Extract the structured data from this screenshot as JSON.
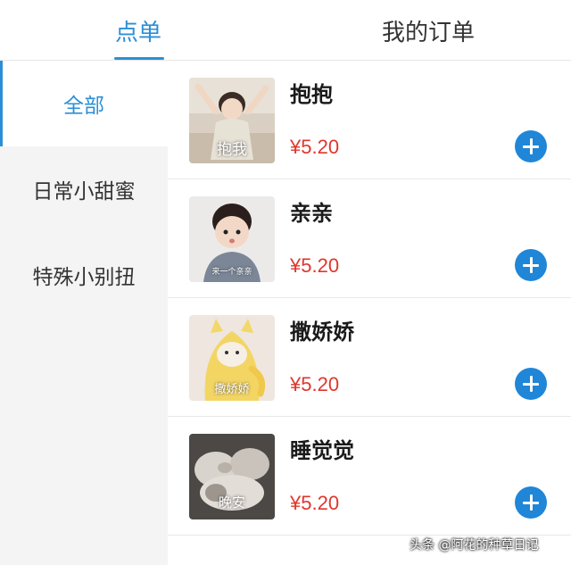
{
  "tabs": {
    "order": "点单",
    "my_orders": "我的订单"
  },
  "sidebar": {
    "items": [
      {
        "label": "全部"
      },
      {
        "label": "日常小甜蜜"
      },
      {
        "label": "特殊小别扭"
      }
    ]
  },
  "products": [
    {
      "name": "抱抱",
      "price": "¥5.20",
      "image_caption": "抱我"
    },
    {
      "name": "亲亲",
      "price": "¥5.20",
      "image_caption": "来一个亲亲"
    },
    {
      "name": "撒娇娇",
      "price": "¥5.20",
      "image_caption": "撒娇娇"
    },
    {
      "name": "睡觉觉",
      "price": "¥5.20",
      "image_caption": "晚安"
    }
  ],
  "watermark": "头条 @阿花的种草日记",
  "colors": {
    "accent": "#2b8fd6",
    "price": "#e0362c",
    "add_button": "#1f86d8"
  }
}
